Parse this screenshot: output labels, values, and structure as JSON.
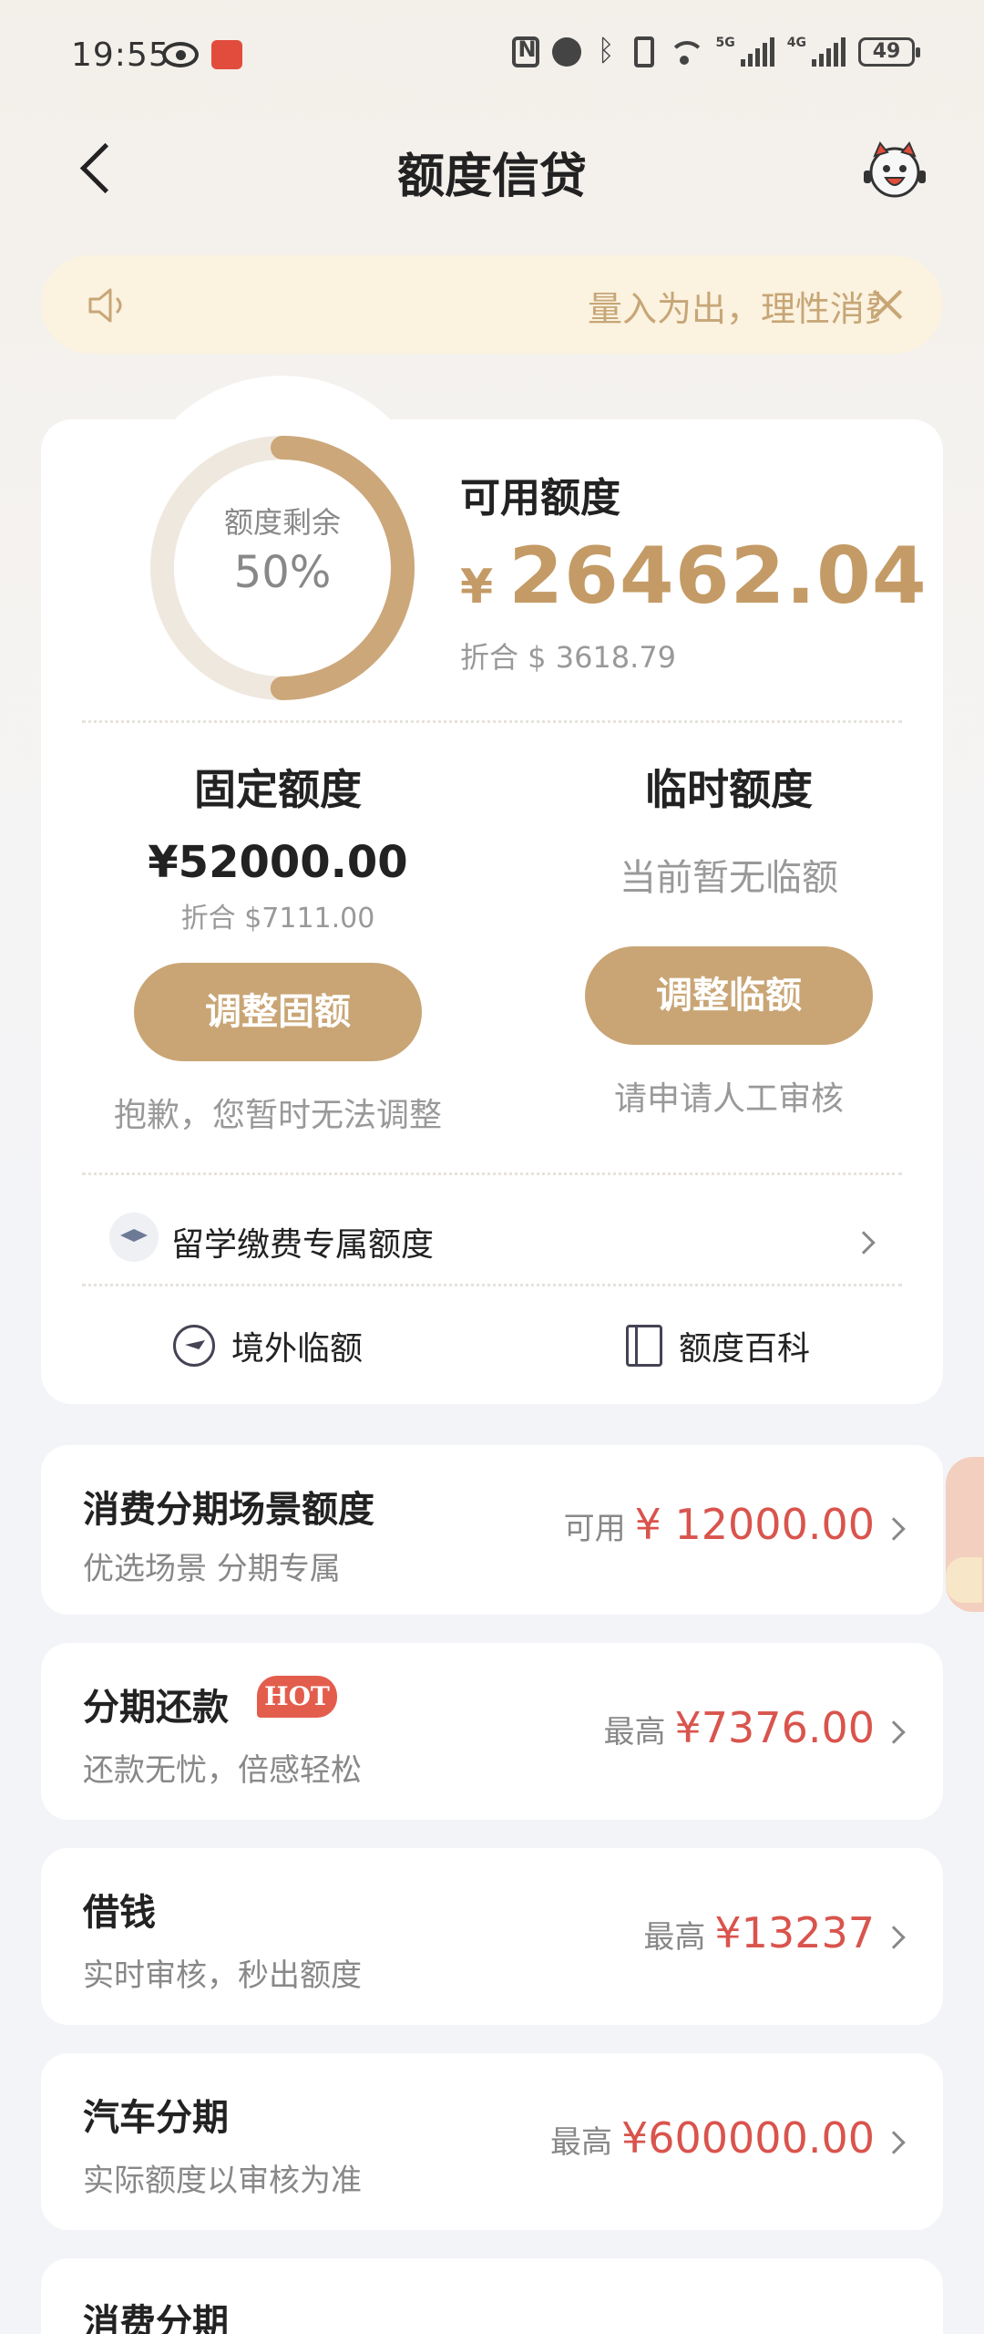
{
  "status_bar": {
    "time": "19:55",
    "battery": "49",
    "net_5g": "5G",
    "net_4g": "4G"
  },
  "header": {
    "title": "额度信贷"
  },
  "notice": {
    "text": "量入为出，理性消费"
  },
  "credit": {
    "ring_label": "额度剩余",
    "ring_percent": "50%",
    "ring_fraction": 0.5,
    "available_label": "可用额度",
    "currency_symbol": "¥",
    "available_amount": "26462.04",
    "available_usd": "折合 $ 3618.79",
    "fixed": {
      "title": "固定额度",
      "amount": "¥52000.00",
      "usd": "折合 $7111.00",
      "button": "调整固额",
      "note": "抱歉，您暂时无法调整"
    },
    "temporary": {
      "title": "临时额度",
      "status": "当前暂无临额",
      "button": "调整临额",
      "note": "请申请人工审核"
    },
    "study_abroad": "留学缴费专属额度",
    "links": [
      "境外临额",
      "额度百科"
    ]
  },
  "products": [
    {
      "title": "消费分期场景额度",
      "subtitle": "优选场景 分期专属",
      "prefix": "可用",
      "amount": "¥ 12000.00"
    },
    {
      "title": "分期还款",
      "badge": "HOT",
      "subtitle": "还款无忧，倍感轻松",
      "prefix": "最高",
      "amount": "¥7376.00"
    },
    {
      "title": "借钱",
      "subtitle": "实时审核，秒出额度",
      "prefix": "最高",
      "amount": "¥13237"
    },
    {
      "title": "汽车分期",
      "subtitle": "实际额度以审核为准",
      "prefix": "最高",
      "amount": "¥600000.00"
    },
    {
      "title": "消费分期"
    }
  ],
  "colors": {
    "gold": "#c49b66",
    "button_gold": "#c9a575",
    "amount_red": "#d9544d",
    "notice_bg": "#fbf2e0"
  }
}
